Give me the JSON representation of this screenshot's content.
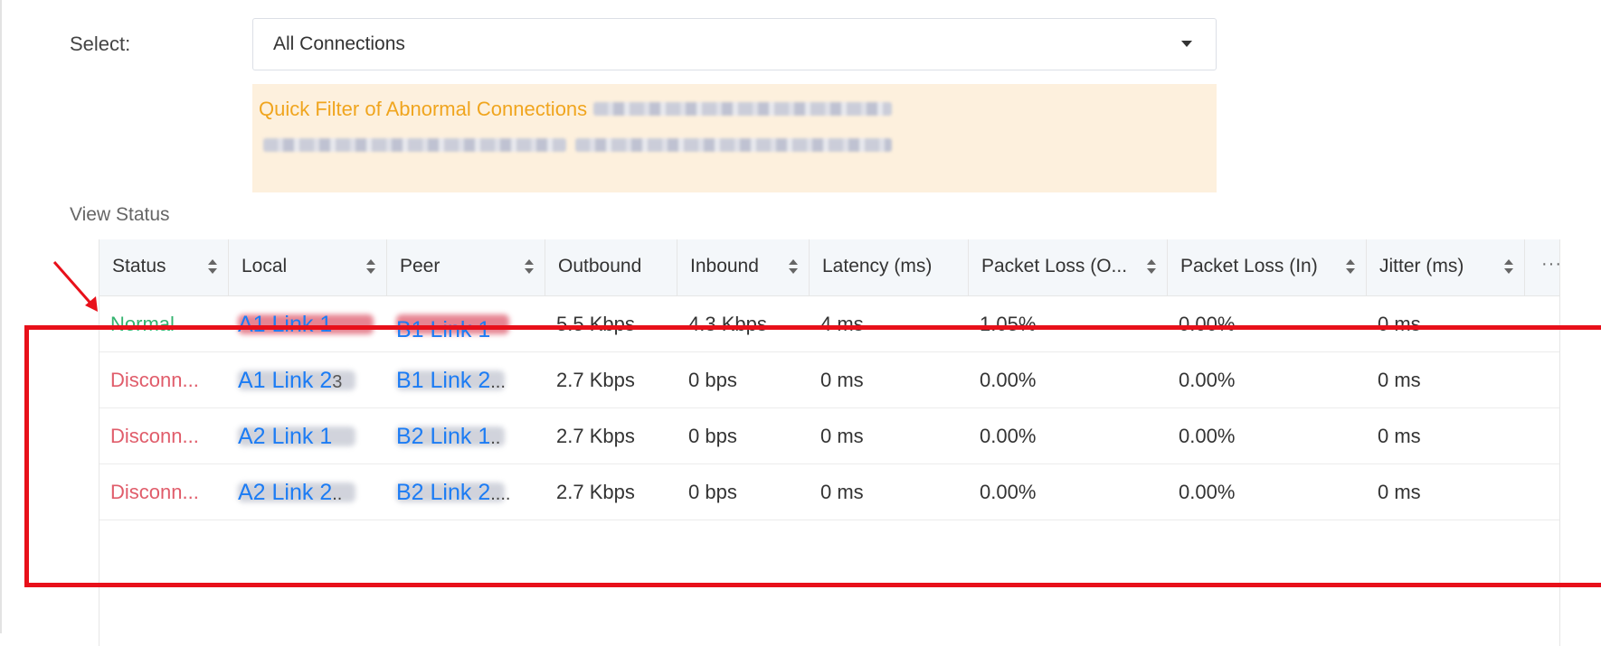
{
  "filter": {
    "label": "Select:",
    "value": "All Connections"
  },
  "banner": {
    "title": "Quick Filter of Abnormal Connections"
  },
  "section_title": "View Status",
  "table": {
    "columns": [
      "Status",
      "Local",
      "Peer",
      "Outbound",
      "Inbound",
      "Latency (ms)",
      "Packet Loss (O...",
      "Packet Loss (In)",
      "Jitter (ms)"
    ],
    "more": "···",
    "rows": [
      {
        "status": "Normal",
        "status_type": "normal",
        "local": "A1 Link 1",
        "local_suffix": "",
        "peer": "B1 Link 1",
        "peer_suffix": "",
        "outbound": "5.5 Kbps",
        "inbound": "4.3 Kbps",
        "latency": "4 ms",
        "loss_out": "1.05%",
        "loss_in": "0.00%",
        "jitter": "0 ms"
      },
      {
        "status": "Disconn...",
        "status_type": "disconnected",
        "local": "A1 Link 2",
        "local_suffix": "3",
        "peer": "B1 Link 2",
        "peer_suffix": "...",
        "outbound": "2.7 Kbps",
        "inbound": "0 bps",
        "latency": "0 ms",
        "loss_out": "0.00%",
        "loss_in": "0.00%",
        "jitter": "0 ms"
      },
      {
        "status": "Disconn...",
        "status_type": "disconnected",
        "local": "A2 Link 1",
        "local_suffix": "",
        "peer": "B2 Link 1",
        "peer_suffix": "..",
        "outbound": "2.7 Kbps",
        "inbound": "0 bps",
        "latency": "0 ms",
        "loss_out": "0.00%",
        "loss_in": "0.00%",
        "jitter": "0 ms"
      },
      {
        "status": "Disconn...",
        "status_type": "disconnected",
        "local": "A2 Link 2",
        "local_suffix": "..",
        "peer": "B2 Link 2",
        "peer_suffix": "....",
        "outbound": "2.7 Kbps",
        "inbound": "0 bps",
        "latency": "0 ms",
        "loss_out": "0.00%",
        "loss_in": "0.00%",
        "jitter": "0 ms"
      }
    ]
  },
  "colors": {
    "normal": "#34b36f",
    "disconnected": "#e05c6a",
    "link": "#1c7cf4",
    "annotation": "#e8101a",
    "banner_bg": "#fdf0dd",
    "banner_text": "#f0a51e"
  }
}
